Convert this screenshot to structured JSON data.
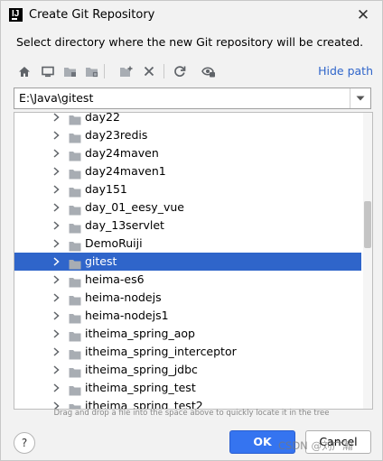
{
  "window": {
    "title": "Create Git Repository",
    "close_glyph": "✕"
  },
  "description": "Select directory where the new Git repository will be created.",
  "toolbar": {
    "buttons": [
      "home-icon",
      "desktop-icon",
      "project-folder-icon",
      "module-folder-icon",
      "new-folder-icon",
      "delete-icon",
      "refresh-icon",
      "show-hidden-icon"
    ],
    "hide_path_label": "Hide path"
  },
  "path": {
    "value": "E:\\Java\\gitest"
  },
  "tree": {
    "items": [
      {
        "label": "day22"
      },
      {
        "label": "day23redis"
      },
      {
        "label": "day24maven"
      },
      {
        "label": "day24maven1"
      },
      {
        "label": "day151"
      },
      {
        "label": "day_01_eesy_vue"
      },
      {
        "label": "day_13servlet"
      },
      {
        "label": "DemoRuiji"
      },
      {
        "label": "gitest",
        "selected": true
      },
      {
        "label": "heima-es6"
      },
      {
        "label": "heima-nodejs"
      },
      {
        "label": "heima-nodejs1"
      },
      {
        "label": "itheima_spring_aop"
      },
      {
        "label": "itheima_spring_interceptor"
      },
      {
        "label": "itheima_spring_jdbc"
      },
      {
        "label": "itheima_spring_test"
      },
      {
        "label": "itheima_spring_test2"
      }
    ]
  },
  "hint": "Drag and drop a file into the space above to quickly locate it in the tree",
  "footer": {
    "help_label": "?",
    "ok_label": "OK",
    "cancel_label": "Cancel"
  },
  "watermark": "CSDN @刘广瀚",
  "colors": {
    "accent": "#3574f0",
    "selection": "#2f65ca",
    "link": "#2f65ca",
    "folder": "#a8adb3"
  }
}
